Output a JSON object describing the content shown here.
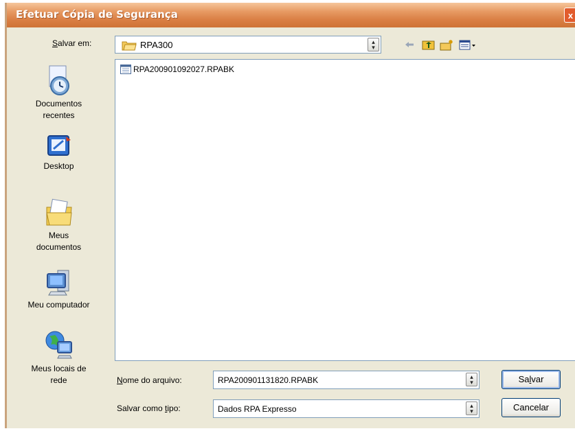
{
  "window": {
    "title": "Efetuar Cópia de Segurança",
    "close_glyph": "x"
  },
  "toolbar": {
    "save_in_label_accel": "S",
    "save_in_label_rest": "alvar em:",
    "folder_value": "RPA300",
    "folder_icon": "folder-icon",
    "icons": [
      "back-arrow-icon",
      "up-folder-icon",
      "new-folder-icon",
      "view-menu-icon"
    ]
  },
  "places": [
    {
      "line1": "Documentos",
      "line2": "recentes",
      "icon": "recent-documents-icon"
    },
    {
      "line1": "Desktop",
      "line2": "",
      "icon": "desktop-icon"
    },
    {
      "line1": "Meus",
      "line2": "documentos",
      "icon": "my-documents-icon"
    },
    {
      "line1": "Meu computador",
      "line2": "",
      "icon": "my-computer-icon"
    },
    {
      "line1": "Meus locais de",
      "line2": "rede",
      "icon": "network-places-icon"
    }
  ],
  "files": [
    {
      "name": "RPA200901092027.RPABK",
      "icon": "backup-file-icon"
    }
  ],
  "filename": {
    "label_accel": "N",
    "label_rest": "ome do arquivo:",
    "value": "RPA200901131820.RPABK"
  },
  "filetype": {
    "label_pre": "Salvar como ",
    "label_accel": "t",
    "label_post": "ipo:",
    "value": "Dados RPA Expresso"
  },
  "buttons": {
    "save_pre": "Sa",
    "save_accel": "l",
    "save_post": "var",
    "cancel": "Cancelar"
  },
  "colors": {
    "titlebar": "#d97e43",
    "dialog_bg": "#ece9d8",
    "field_border": "#7f9db9"
  }
}
